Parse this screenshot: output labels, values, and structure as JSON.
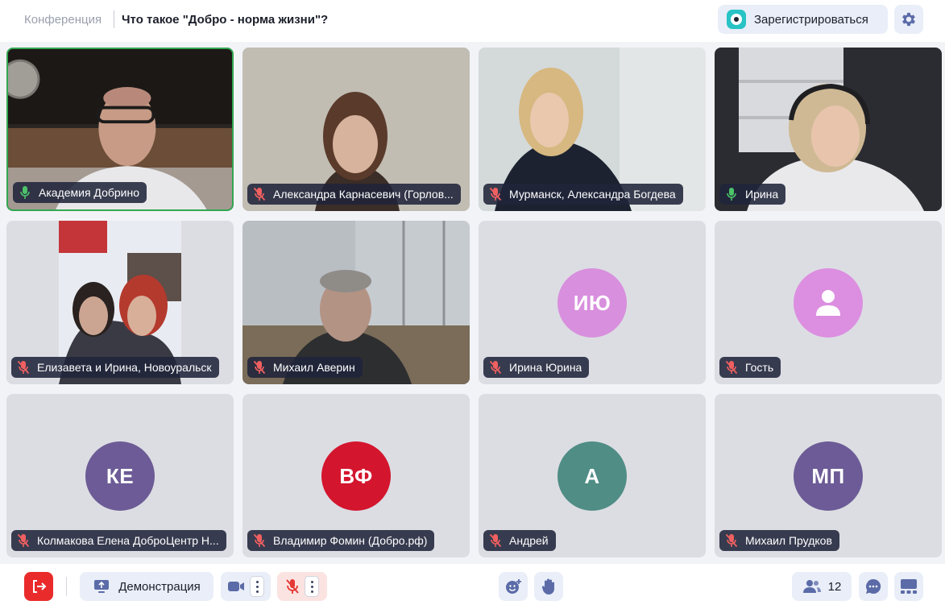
{
  "header": {
    "section": "Конференция",
    "title": "Что такое \"Добро - норма жизни\"?",
    "register_label": "Зарегистрироваться"
  },
  "colors": {
    "accent": "#5b6ba8",
    "active_speaker_border": "#33a651",
    "mic_on": "#4cc36a",
    "mic_off": "#f06060",
    "leave_red": "#ea2b2b"
  },
  "tiles": [
    {
      "name": "Академия Добрино",
      "mic": "on",
      "type": "video",
      "active": true
    },
    {
      "name": "Александра Карнасевич (Горлов...",
      "mic": "off",
      "type": "video"
    },
    {
      "name": "Мурманск, Александра Богдева",
      "mic": "off",
      "type": "video"
    },
    {
      "name": "Ирина",
      "mic": "on",
      "type": "video"
    },
    {
      "name": "Елизавета и Ирина, Новоуральск",
      "mic": "off",
      "type": "video"
    },
    {
      "name": "Михаил Аверин",
      "mic": "off",
      "type": "video"
    },
    {
      "name": "Ирина Юрина",
      "mic": "off",
      "type": "avatar",
      "initials": "ИЮ",
      "avatar_color": "#d88fdd"
    },
    {
      "name": "Гость",
      "mic": "off",
      "type": "avatar",
      "icon": "person-icon",
      "avatar_color": "#dc8fe0"
    },
    {
      "name": "Колмакова Елена ДоброЦентр Н...",
      "mic": "off",
      "type": "avatar",
      "initials": "КЕ",
      "avatar_color": "#6c5b96"
    },
    {
      "name": "Владимир Фомин (Добро.рф)",
      "mic": "off",
      "type": "avatar",
      "initials": "ВФ",
      "avatar_color": "#d4152e"
    },
    {
      "name": "Андрей",
      "mic": "off",
      "type": "avatar",
      "initials": "А",
      "avatar_color": "#4f8d85"
    },
    {
      "name": "Михаил Прудков",
      "mic": "off",
      "type": "avatar",
      "initials": "МП",
      "avatar_color": "#6c5b96"
    }
  ],
  "toolbar": {
    "leave_icon": "exit-icon",
    "demo_label": "Демонстрация",
    "camera_icon": "camera-icon",
    "mic_icon": "mic-off-icon",
    "reactions_icon": "emoji-icon",
    "raise_hand_icon": "hand-icon",
    "participants_count": "12",
    "chat_icon": "chat-icon",
    "layout_icon": "layout-icon"
  }
}
